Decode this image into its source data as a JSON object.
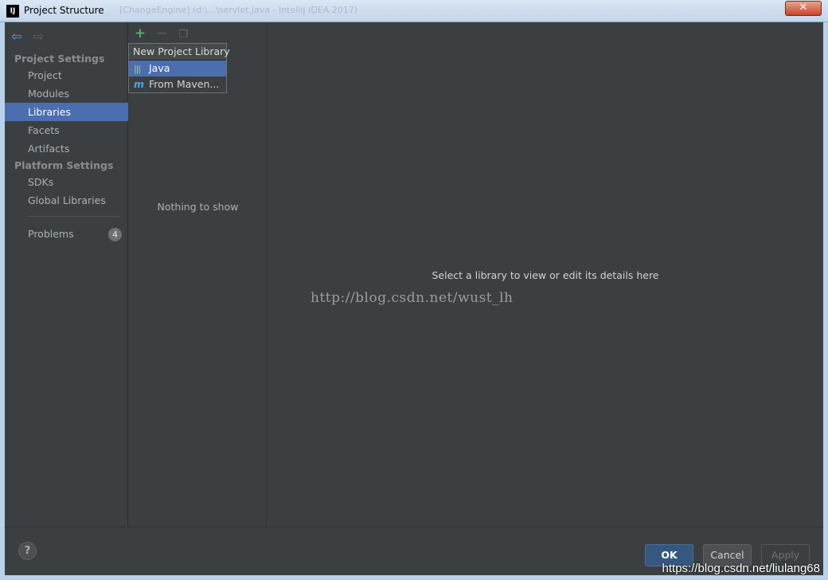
{
  "window": {
    "icon_text": "IJ",
    "title": "Project Structure",
    "background_title": "[ChangeEngine] (d:\\...\\servlet.java - IntelliJ IDEA 2017)",
    "close_label": "✕"
  },
  "sidebar": {
    "project_settings_header": "Project Settings",
    "platform_settings_header": "Platform Settings",
    "items": [
      {
        "label": "Project"
      },
      {
        "label": "Modules"
      },
      {
        "label": "Libraries"
      },
      {
        "label": "Facets"
      },
      {
        "label": "Artifacts"
      },
      {
        "label": "SDKs"
      },
      {
        "label": "Global Libraries"
      }
    ],
    "problems": {
      "label": "Problems",
      "count": "4"
    }
  },
  "middle": {
    "empty_text": "Nothing to show"
  },
  "popup": {
    "title": "New Project Library",
    "items": [
      {
        "label": "Java",
        "icon": "java-library-icon"
      },
      {
        "label": "From Maven...",
        "icon": "maven-icon"
      }
    ]
  },
  "details": {
    "message": "Select a library to view or edit its details here",
    "watermark": "http://blog.csdn.net/wust_lh"
  },
  "footer": {
    "help_label": "?",
    "ok_label": "OK",
    "cancel_label": "Cancel",
    "apply_label": "Apply",
    "watermark": "https://blog.csdn.net/liulang68"
  },
  "colors": {
    "selection": "#4b6eaf",
    "panel": "#3c3f41",
    "add_icon": "#59a869"
  }
}
